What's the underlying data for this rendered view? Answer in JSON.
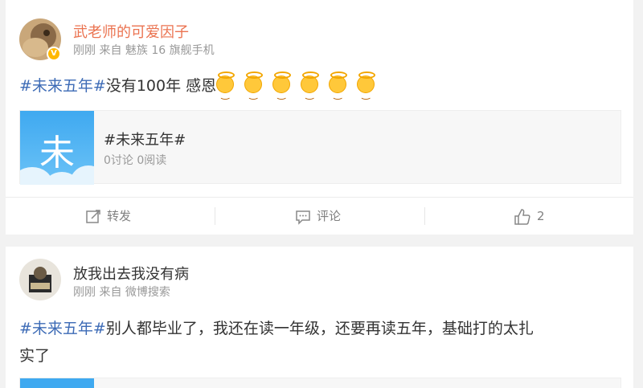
{
  "posts": [
    {
      "username": "武老师的可爱因子",
      "meta": "刚刚 来自 魅族 16 旗舰手机",
      "verified_badge": "V",
      "hashtag": "#未来五年#",
      "text": "没有100年 感恩",
      "emojis": [
        "angel-emoji",
        "angel-emoji",
        "angel-emoji",
        "angel-emoji",
        "angel-emoji",
        "angel-emoji"
      ],
      "topic": {
        "thumb_char": "未",
        "title": "#未来五年#",
        "stats": "0讨论 0阅读"
      },
      "actions": {
        "repost": "转发",
        "comment": "评论",
        "like_count": "2"
      }
    },
    {
      "username": "放我出去我没有病",
      "meta": "刚刚 来自 微博搜索",
      "hashtag": "#未来五年#",
      "text_line1": "别人都毕业了，我还在读一年级，还要再读五年，基础打的太扎",
      "text_line2": "实了"
    }
  ],
  "colors": {
    "link": "#3d6bb6",
    "orange_name": "#eb7350",
    "badge": "#ffb800",
    "meta": "#999999"
  }
}
